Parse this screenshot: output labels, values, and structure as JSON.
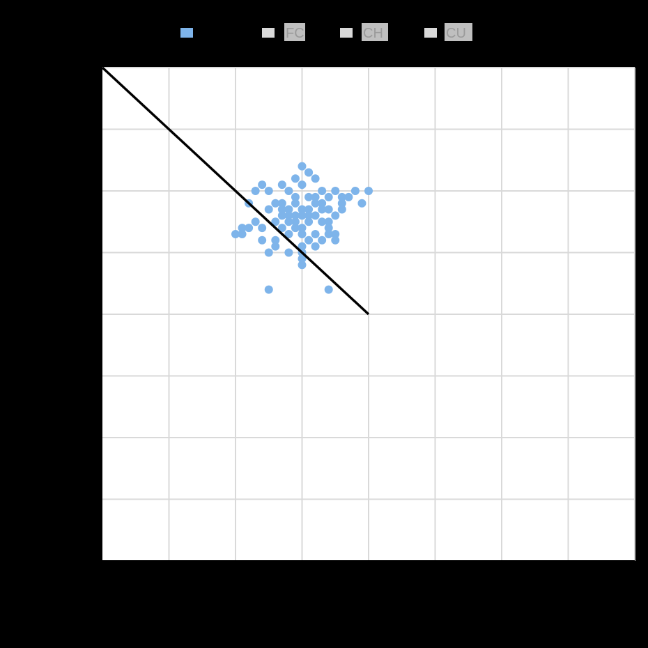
{
  "chart_data": {
    "type": "scatter",
    "title": "",
    "xlabel": "",
    "ylabel": "",
    "grid": true,
    "legend_position": "top",
    "colors": {
      "background": "#000000",
      "plot_area": "#ffffff",
      "grid": "#d9d9d9",
      "points": "#7eb4ea",
      "reference_line": "#000000",
      "legend_swatch_inactive": "#d9d9d9",
      "legend_label_bg": "#bfbfbf"
    },
    "legend": [
      {
        "label": "",
        "swatch": "#7eb4ea"
      },
      {
        "label": "FC",
        "swatch": "#d9d9d9"
      },
      {
        "label": "CH",
        "swatch": "#d9d9d9"
      },
      {
        "label": "CU",
        "swatch": "#d9d9d9"
      }
    ],
    "xlim": [
      0,
      8
    ],
    "ylim": [
      0,
      8
    ],
    "x_ticks": [
      0,
      1,
      2,
      3,
      4,
      5,
      6,
      7,
      8
    ],
    "y_ticks": [
      0,
      1,
      2,
      3,
      4,
      5,
      6,
      7,
      8
    ],
    "reference_line": {
      "x": [
        0,
        4
      ],
      "y": [
        8,
        4
      ]
    },
    "series": [
      {
        "name": "",
        "points": [
          [
            3.0,
            5.7
          ],
          [
            3.1,
            5.6
          ],
          [
            3.2,
            5.8
          ],
          [
            2.9,
            5.5
          ],
          [
            2.8,
            5.6
          ],
          [
            3.3,
            5.5
          ],
          [
            3.1,
            5.9
          ],
          [
            2.7,
            5.7
          ],
          [
            3.0,
            5.4
          ],
          [
            3.2,
            5.3
          ],
          [
            2.9,
            5.9
          ],
          [
            3.4,
            5.7
          ],
          [
            3.1,
            5.2
          ],
          [
            2.6,
            5.5
          ],
          [
            3.3,
            6.0
          ],
          [
            2.8,
            5.3
          ],
          [
            3.0,
            6.1
          ],
          [
            3.4,
            5.4
          ],
          [
            2.5,
            5.7
          ],
          [
            3.2,
            6.2
          ],
          [
            2.7,
            5.4
          ],
          [
            3.5,
            5.6
          ],
          [
            2.6,
            5.2
          ],
          [
            3.0,
            5.1
          ],
          [
            2.4,
            5.4
          ],
          [
            3.6,
            5.9
          ],
          [
            2.9,
            6.2
          ],
          [
            3.3,
            5.2
          ],
          [
            2.3,
            5.5
          ],
          [
            3.5,
            5.3
          ],
          [
            2.8,
            6.0
          ],
          [
            3.1,
            6.3
          ],
          [
            2.2,
            5.8
          ],
          [
            2.3,
            6.0
          ],
          [
            2.5,
            6.0
          ],
          [
            2.4,
            6.1
          ],
          [
            2.7,
            6.1
          ],
          [
            3.0,
            6.4
          ],
          [
            3.1,
            6.3
          ],
          [
            3.4,
            5.9
          ],
          [
            3.6,
            5.7
          ],
          [
            3.5,
            6.0
          ],
          [
            3.7,
            5.9
          ],
          [
            3.9,
            5.8
          ],
          [
            4.0,
            6.0
          ],
          [
            3.8,
            6.0
          ],
          [
            2.2,
            5.4
          ],
          [
            2.1,
            5.4
          ],
          [
            2.4,
            5.2
          ],
          [
            2.6,
            5.1
          ],
          [
            2.5,
            5.0
          ],
          [
            2.8,
            5.0
          ],
          [
            3.0,
            5.0
          ],
          [
            3.2,
            5.1
          ],
          [
            3.4,
            5.3
          ],
          [
            3.5,
            5.2
          ],
          [
            3.0,
            4.9
          ],
          [
            3.0,
            4.8
          ],
          [
            2.5,
            4.4
          ],
          [
            3.4,
            4.4
          ],
          [
            2.1,
            5.3
          ],
          [
            2.0,
            5.3
          ],
          [
            3.6,
            5.8
          ],
          [
            3.3,
            5.8
          ],
          [
            2.9,
            5.8
          ],
          [
            2.7,
            5.8
          ],
          [
            2.8,
            5.5
          ],
          [
            3.1,
            5.5
          ],
          [
            3.2,
            5.6
          ],
          [
            3.0,
            5.3
          ],
          [
            2.9,
            5.4
          ],
          [
            3.2,
            5.9
          ],
          [
            2.6,
            5.8
          ],
          [
            3.4,
            5.5
          ],
          [
            3.3,
            5.7
          ],
          [
            2.7,
            5.6
          ],
          [
            3.1,
            5.7
          ],
          [
            2.8,
            5.7
          ],
          [
            3.0,
            5.6
          ],
          [
            2.9,
            5.6
          ]
        ]
      }
    ]
  }
}
